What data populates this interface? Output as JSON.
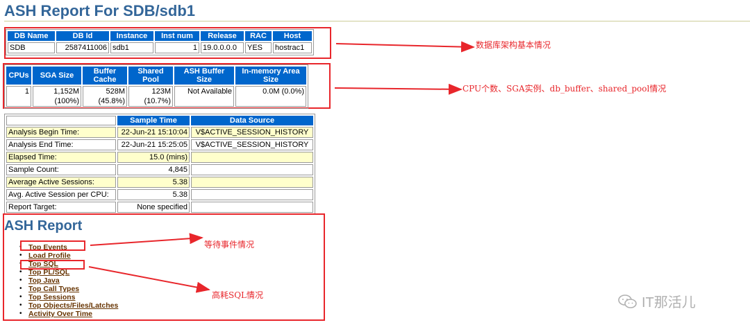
{
  "title": "ASH Report For SDB/sdb1",
  "db_table": {
    "headers": [
      "DB Name",
      "DB Id",
      "Instance",
      "Inst num",
      "Release",
      "RAC",
      "Host"
    ],
    "row": [
      "SDB",
      "2587411006",
      "sdb1",
      "1",
      "19.0.0.0.0",
      "YES",
      "hostrac1"
    ]
  },
  "cpu_table": {
    "headers": [
      "CPUs",
      "SGA Size",
      "Buffer Cache",
      "Shared Pool",
      "ASH Buffer Size",
      "In-memory Area Size"
    ],
    "row": [
      "1",
      "1,152M (100%)",
      "528M (45.8%)",
      "123M (10.7%)",
      "Not Available",
      "0.0M (0.0%)"
    ]
  },
  "sample_table": {
    "headers": [
      "",
      "Sample Time",
      "Data Source"
    ],
    "rows": [
      [
        "Analysis Begin Time:",
        "22-Jun-21 15:10:04",
        "V$ACTIVE_SESSION_HISTORY"
      ],
      [
        "Analysis End Time:",
        "22-Jun-21 15:25:05",
        "V$ACTIVE_SESSION_HISTORY"
      ],
      [
        "Elapsed Time:",
        "15.0 (mins)",
        ""
      ],
      [
        "Sample Count:",
        "4,845",
        ""
      ],
      [
        "Average Active Sessions:",
        "5.38",
        ""
      ],
      [
        "Avg. Active Session per CPU:",
        "5.38",
        ""
      ],
      [
        "Report Target:",
        "None specified",
        ""
      ]
    ]
  },
  "section_title": "ASH Report",
  "links": [
    "Top Events",
    "Load Profile",
    "Top SQL",
    "Top PL/SQL",
    "Top Java",
    "Top Call Types",
    "Top Sessions",
    "Top Objects/Files/Latches",
    "Activity Over Time"
  ],
  "annotations": {
    "db_info": "数据库架构基本情况",
    "cpu_info": "CPU个数、SGA实例、db_buffer、shared_pool情况",
    "events": "等待事件情况",
    "sql": "高耗SQL情况"
  },
  "watermark": "IT那活儿",
  "colors": {
    "header_bg": "#0066cc",
    "title": "#336699",
    "highlight": "#ffffcc",
    "link": "#663300",
    "annotation": "#e8262b"
  }
}
